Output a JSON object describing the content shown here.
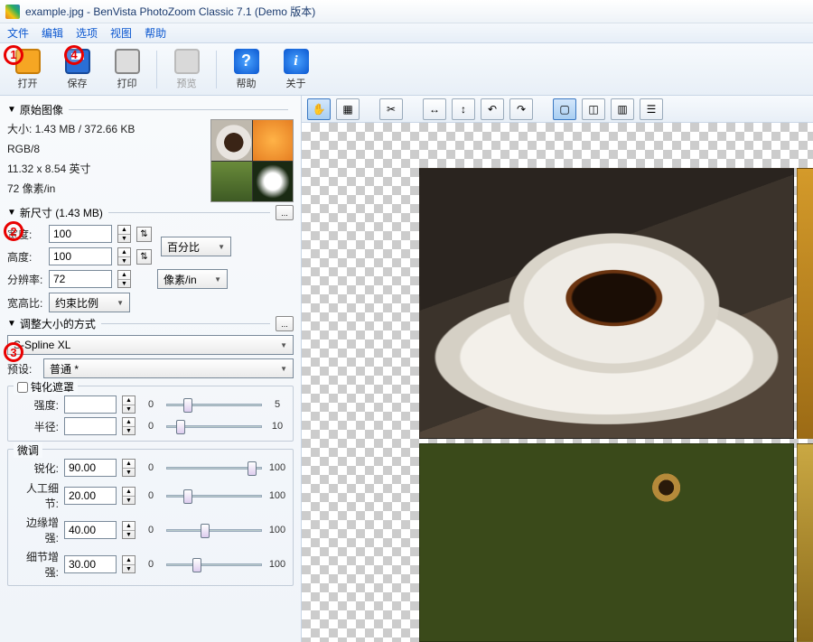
{
  "window": {
    "title": "example.jpg - BenVista PhotoZoom Classic 7.1 (Demo 版本)"
  },
  "menu": {
    "file": "文件",
    "edit": "编辑",
    "options": "选项",
    "view": "视图",
    "help": "帮助"
  },
  "toolbar": {
    "open": "打开",
    "save": "保存",
    "print": "打印",
    "preview": "预览",
    "help": "帮助",
    "about": "关于"
  },
  "annotations": {
    "a1": "1",
    "a2": "2",
    "a3": "3",
    "a4": "4"
  },
  "original": {
    "header": "原始图像",
    "size_line": "大小: 1.43 MB / 372.66 KB",
    "mode": "RGB/8",
    "dims": "11.32 x 8.54 英寸",
    "dpi": "72 像素/in"
  },
  "newsize": {
    "header": "新尺寸 (1.43 MB)",
    "width_label": "宽度:",
    "width_value": "100",
    "height_label": "高度:",
    "height_value": "100",
    "unit_combo": "百分比",
    "res_label": "分辨率:",
    "res_value": "72",
    "res_unit": "像素/in",
    "aspect_label": "宽高比:",
    "aspect_value": "约束比例"
  },
  "resize_method": {
    "header": "调整大小的方式",
    "algo": "S-Spline XL",
    "preset_label": "预设:",
    "preset_value": "普通 *"
  },
  "unsharp": {
    "title": "钝化遮罩",
    "strength_label": "强度:",
    "strength_value": "",
    "strength_min": "0",
    "strength_max": "5",
    "radius_label": "半径:",
    "radius_value": "",
    "radius_min": "0",
    "radius_max": "10"
  },
  "finetune": {
    "title": "微调",
    "sharp_label": "锐化:",
    "sharp_value": "90.00",
    "detail_label": "人工细节:",
    "detail_value": "20.00",
    "edge_label": "边缘增强:",
    "edge_value": "40.00",
    "fine_label": "细节增强:",
    "fine_value": "30.00",
    "min": "0",
    "max": "100"
  }
}
